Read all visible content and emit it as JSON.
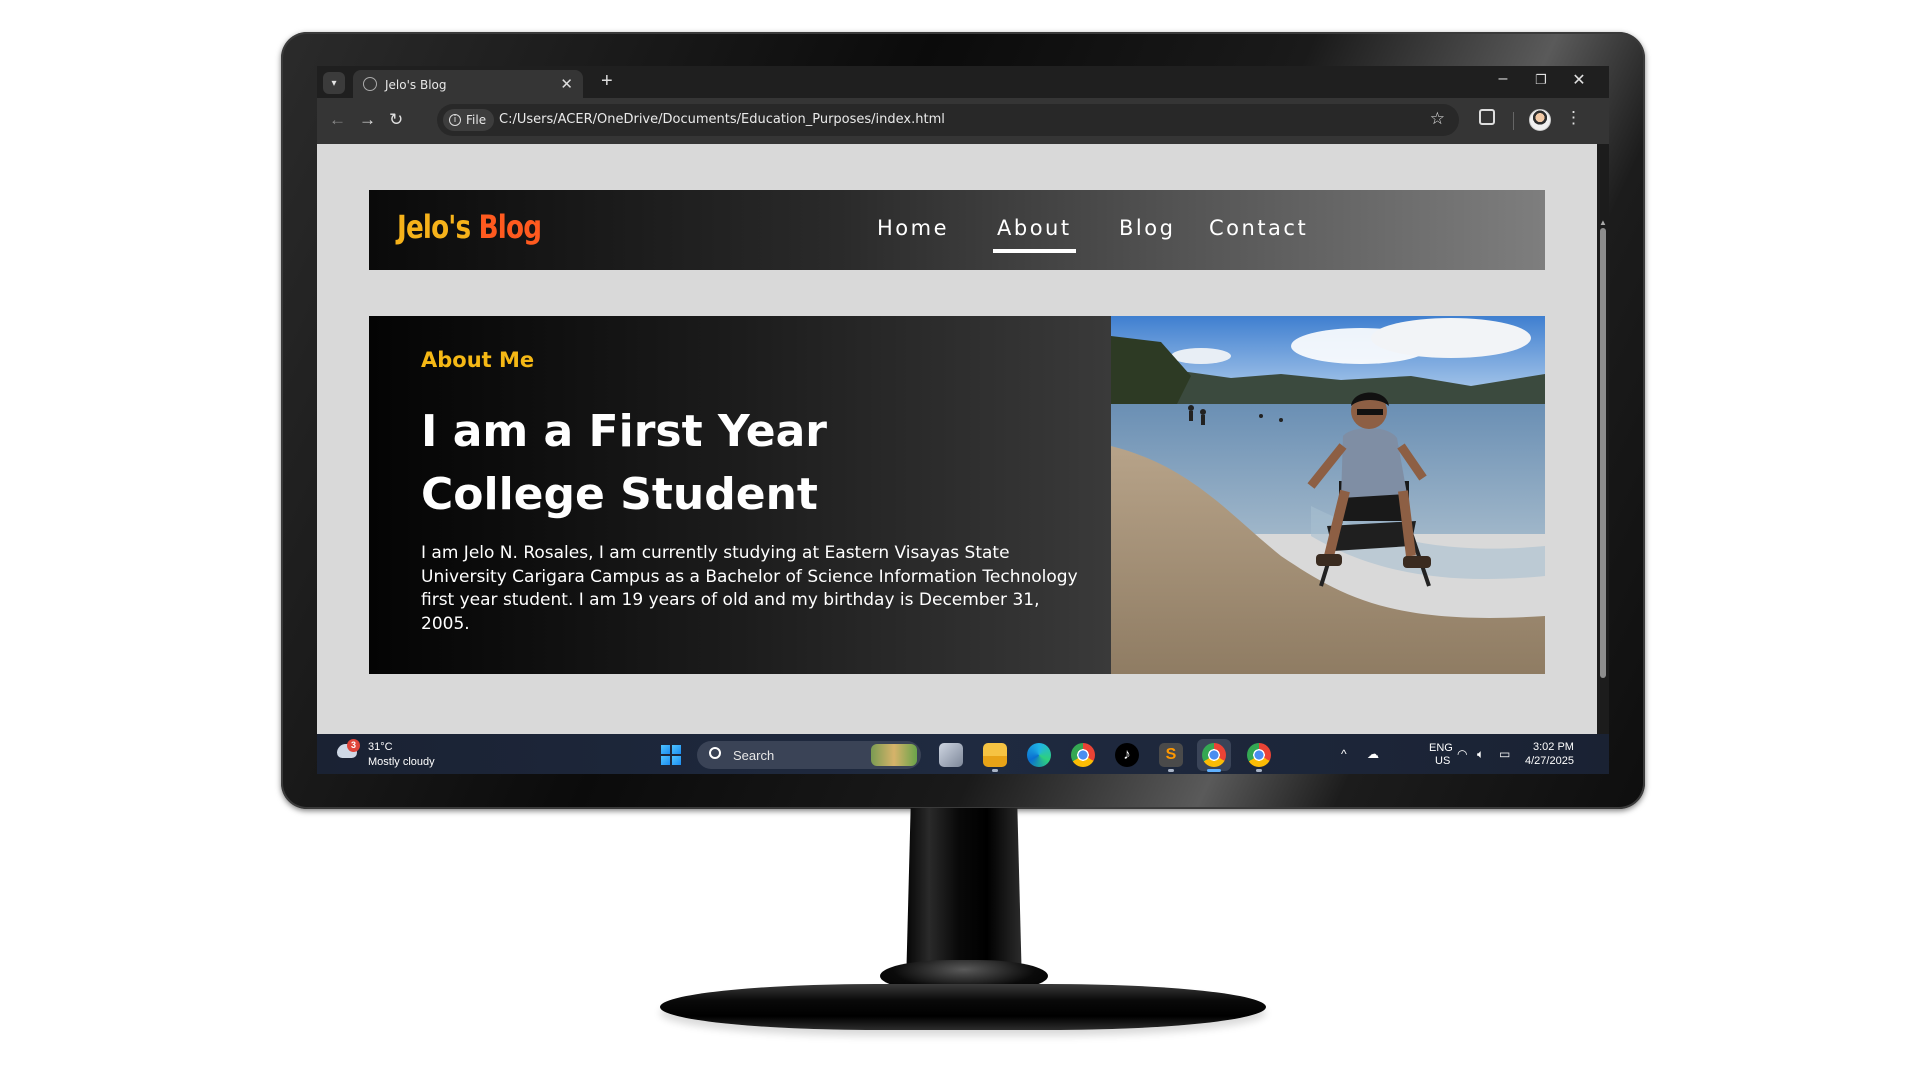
{
  "browser": {
    "tab_title": "Jelo's Blog",
    "security_chip": "File",
    "url": "C:/Users/ACER/OneDrive/Documents/Education_Purposes/index.html"
  },
  "site": {
    "logo_part1": "Jelo's",
    "logo_part2": "Blog",
    "nav": [
      "Home",
      "About",
      "Blog",
      "Contact"
    ],
    "active_nav": "About",
    "colors": {
      "accent_yellow": "#f5b815",
      "accent_orange": "#ff5a1f",
      "page_bg": "#d9d9d9"
    }
  },
  "about": {
    "eyebrow": "About Me",
    "headline": "I am a First Year College Student",
    "bio": "I am Jelo N. Rosales, I am currently studying at Eastern Visayas State  University Carigara Campus as a Bachelor of Science Information Technology first year student. I am 19 years of old and my birthday is December 31, 2005."
  },
  "taskbar": {
    "weather_badge": "3",
    "temperature": "31°C",
    "condition": "Mostly cloudy",
    "search_label": "Search",
    "language_line1": "ENG",
    "language_line2": "US",
    "time": "3:02 PM",
    "date": "4/27/2025",
    "pinned_apps": [
      "task-view-icon",
      "file-explorer-icon",
      "edge-icon",
      "chrome-icon",
      "tiktok-icon",
      "sublime-text-icon",
      "chrome-profile-icon",
      "chrome-icon"
    ]
  }
}
